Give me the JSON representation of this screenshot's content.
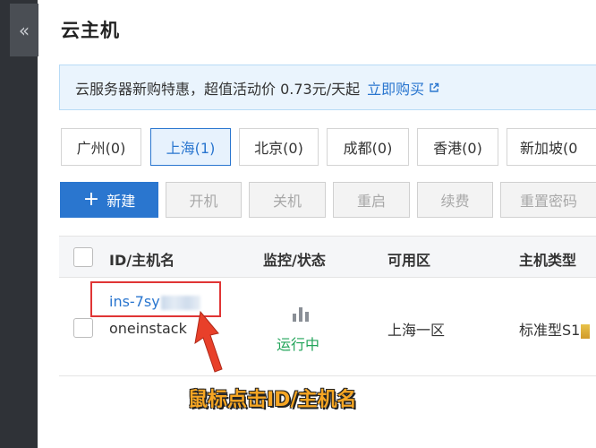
{
  "sidebar": {
    "collapse_glyph": "«"
  },
  "page": {
    "title": "云主机"
  },
  "promo": {
    "text": "云服务器新购特惠，超值活动价 0.73元/天起",
    "link_label": "立即购买",
    "link_icon": "external-link-icon"
  },
  "regions": [
    {
      "label": "广州(0)",
      "active": false
    },
    {
      "label": "上海(1)",
      "active": true
    },
    {
      "label": "北京(0)",
      "active": false
    },
    {
      "label": "成都(0)",
      "active": false
    },
    {
      "label": "香港(0)",
      "active": false
    },
    {
      "label": "新加坡(0",
      "active": false
    }
  ],
  "toolbar": {
    "create_plus": "+",
    "create_label": "新建",
    "power_on_label": "开机",
    "power_off_label": "关机",
    "restart_label": "重启",
    "renew_label": "续费",
    "reset_password_label": "重置密码"
  },
  "table": {
    "headers": {
      "id_name": "ID/主机名",
      "monitor_status": "监控/状态",
      "zone": "可用区",
      "host_type": "主机类型"
    },
    "rows": [
      {
        "id_visible": "ins-7sy",
        "name": "oneinstack",
        "status": "运行中",
        "zone": "上海一区",
        "host_type": "标准型S1"
      }
    ]
  },
  "annotation": {
    "text": "鼠标点击ID/主机名"
  },
  "colors": {
    "accent": "#2a76cf",
    "status_running": "#22a45a",
    "highlight": "#e03535",
    "annotation_fill": "#f6a623"
  }
}
